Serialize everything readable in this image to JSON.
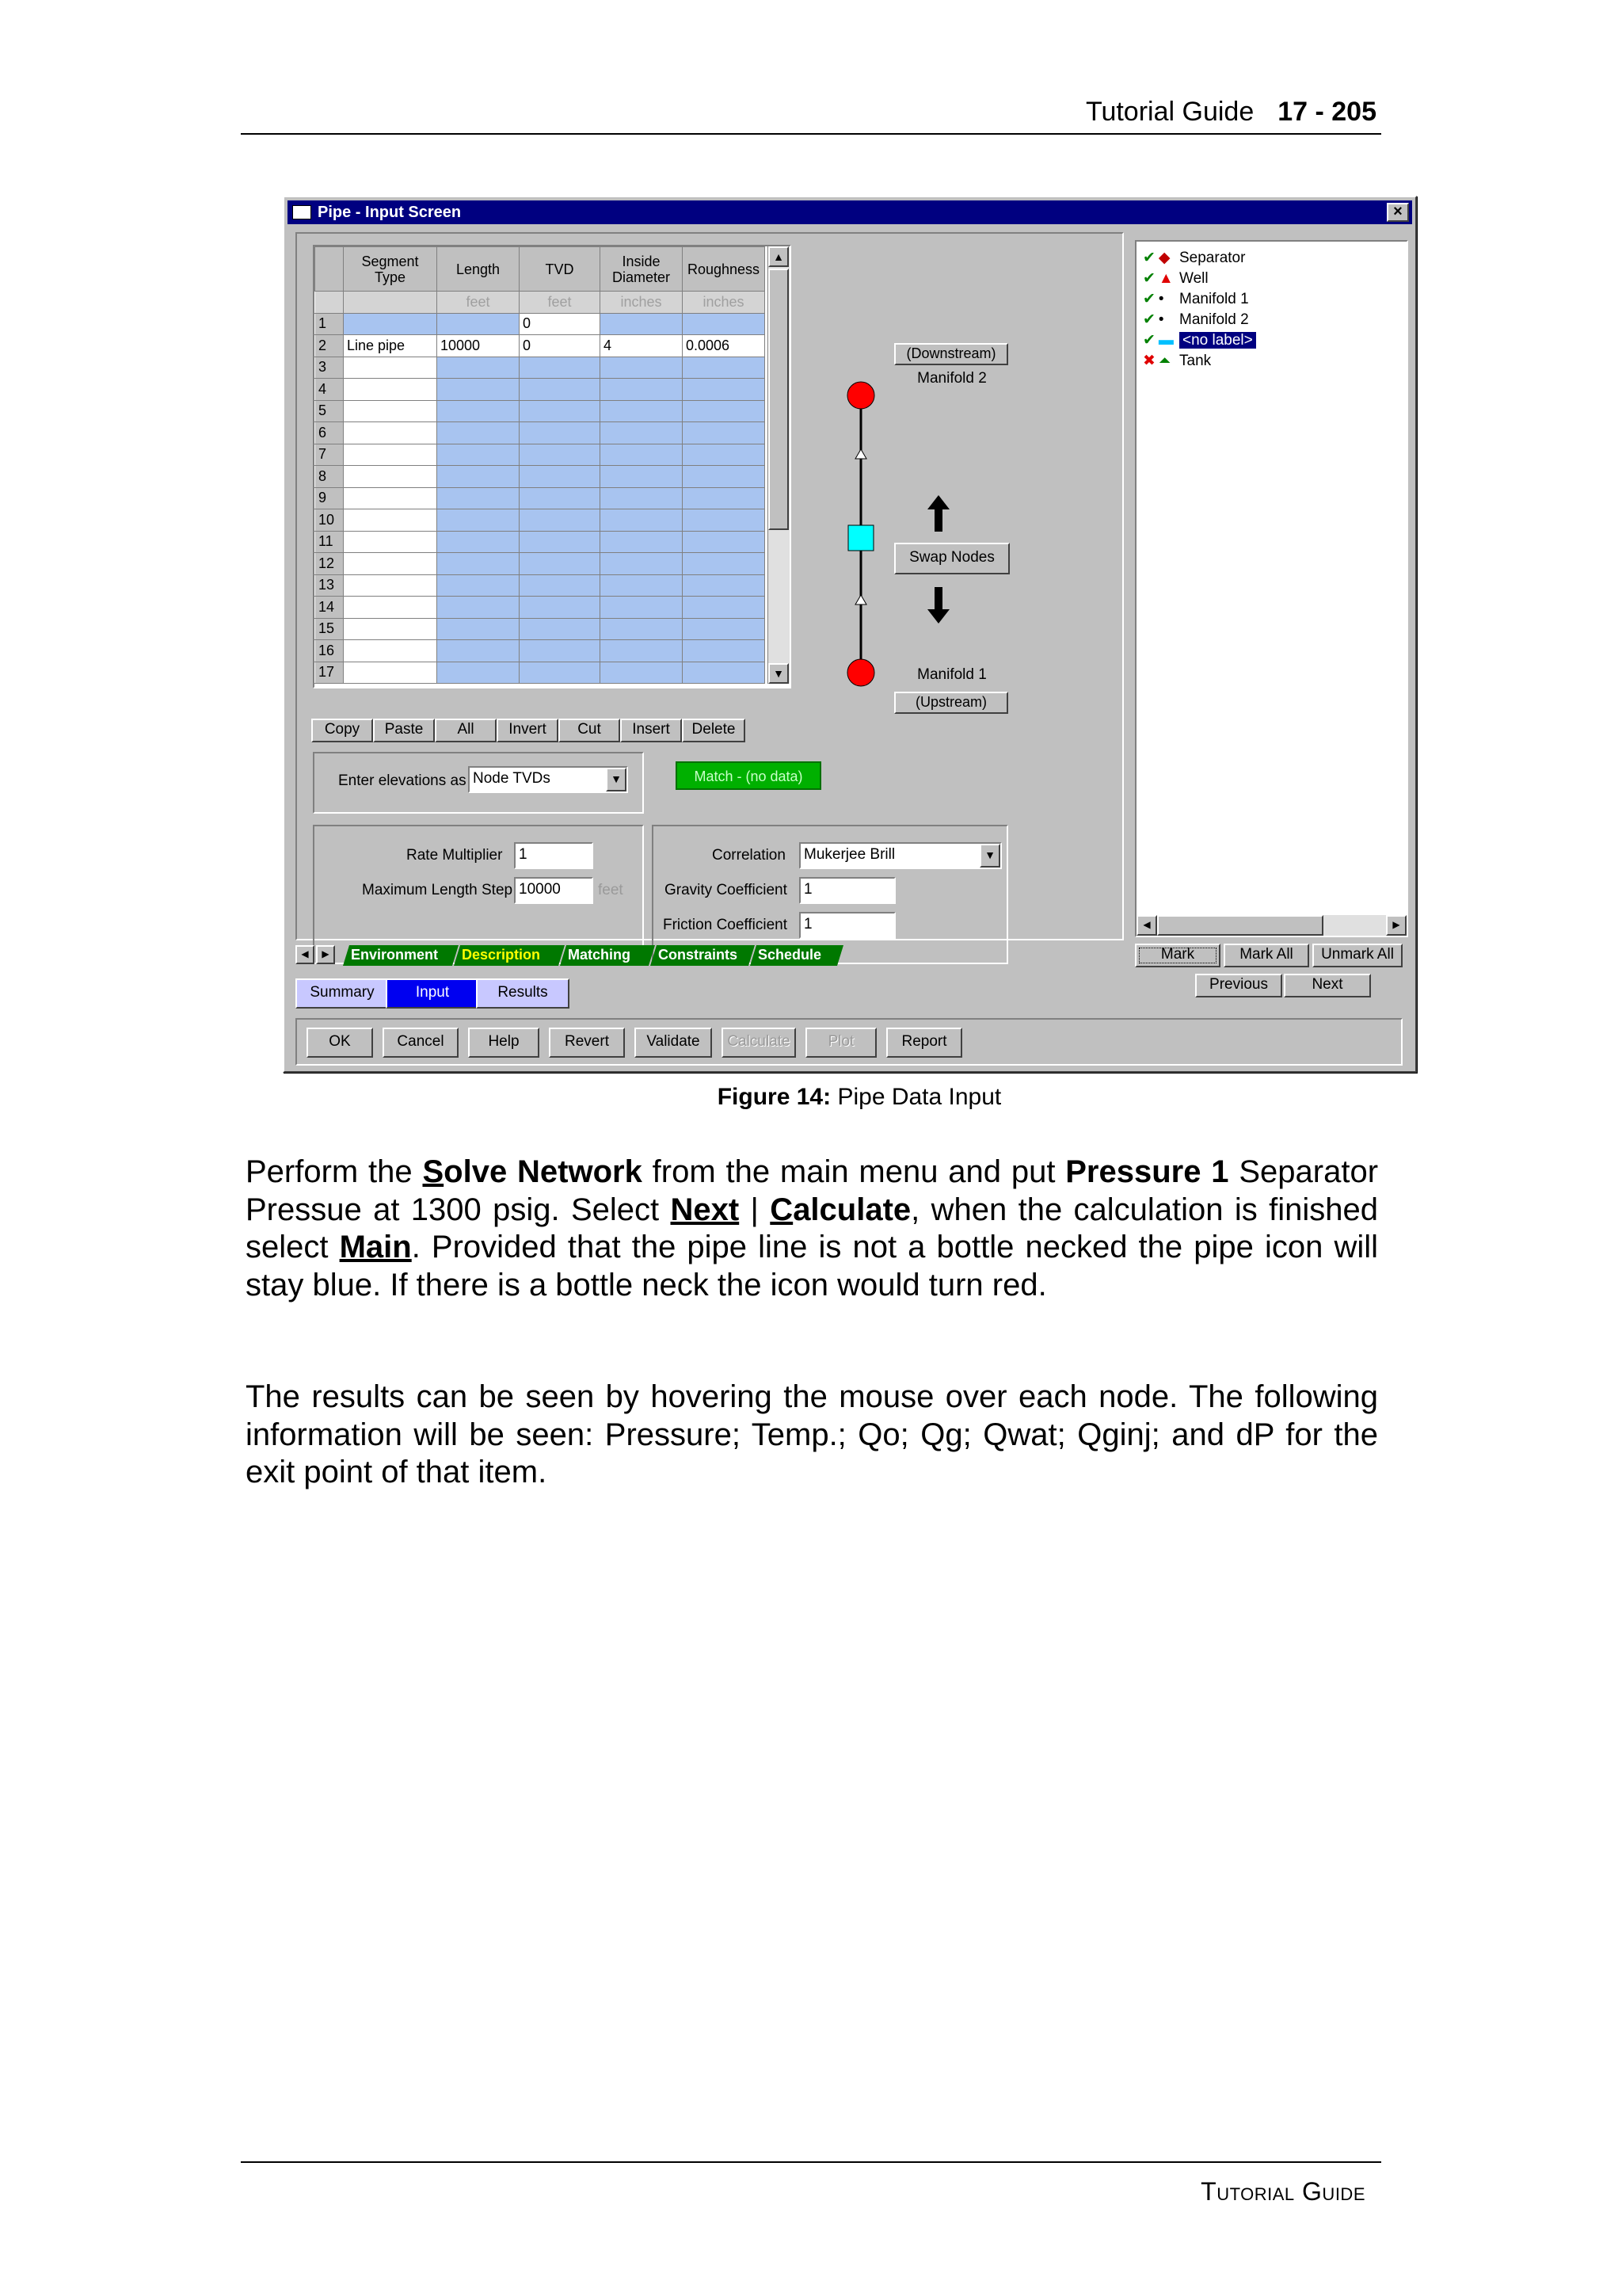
{
  "page_header": {
    "title": "Tutorial Guide",
    "page_number": "17 - 205"
  },
  "window": {
    "title": "Pipe - Input Screen",
    "close_label": "×",
    "grid": {
      "headers": [
        "Segment Type",
        "Length",
        "TVD",
        "Inside Diameter",
        "Roughness"
      ],
      "units": [
        "",
        "feet",
        "feet",
        "inches",
        "inches"
      ],
      "rows": [
        {
          "n": "1",
          "type": "",
          "length": "",
          "tvd": "0",
          "diameter": "",
          "roughness": ""
        },
        {
          "n": "2",
          "type": "Line pipe",
          "length": "10000",
          "tvd": "0",
          "diameter": "4",
          "roughness": "0.0006"
        },
        {
          "n": "3",
          "type": "",
          "length": "",
          "tvd": "",
          "diameter": "",
          "roughness": ""
        },
        {
          "n": "4",
          "type": "",
          "length": "",
          "tvd": "",
          "diameter": "",
          "roughness": ""
        },
        {
          "n": "5",
          "type": "",
          "length": "",
          "tvd": "",
          "diameter": "",
          "roughness": ""
        },
        {
          "n": "6",
          "type": "",
          "length": "",
          "tvd": "",
          "diameter": "",
          "roughness": ""
        },
        {
          "n": "7",
          "type": "",
          "length": "",
          "tvd": "",
          "diameter": "",
          "roughness": ""
        },
        {
          "n": "8",
          "type": "",
          "length": "",
          "tvd": "",
          "diameter": "",
          "roughness": ""
        },
        {
          "n": "9",
          "type": "",
          "length": "",
          "tvd": "",
          "diameter": "",
          "roughness": ""
        },
        {
          "n": "10",
          "type": "",
          "length": "",
          "tvd": "",
          "diameter": "",
          "roughness": ""
        },
        {
          "n": "11",
          "type": "",
          "length": "",
          "tvd": "",
          "diameter": "",
          "roughness": ""
        },
        {
          "n": "12",
          "type": "",
          "length": "",
          "tvd": "",
          "diameter": "",
          "roughness": ""
        },
        {
          "n": "13",
          "type": "",
          "length": "",
          "tvd": "",
          "diameter": "",
          "roughness": ""
        },
        {
          "n": "14",
          "type": "",
          "length": "",
          "tvd": "",
          "diameter": "",
          "roughness": ""
        },
        {
          "n": "15",
          "type": "",
          "length": "",
          "tvd": "",
          "diameter": "",
          "roughness": ""
        },
        {
          "n": "16",
          "type": "",
          "length": "",
          "tvd": "",
          "diameter": "",
          "roughness": ""
        },
        {
          "n": "17",
          "type": "",
          "length": "",
          "tvd": "",
          "diameter": "",
          "roughness": ""
        }
      ]
    },
    "grid_buttons": [
      "Copy",
      "Paste",
      "All",
      "Invert",
      "Cut",
      "Insert",
      "Delete"
    ],
    "diagram": {
      "downstream_label": "(Downstream)",
      "downstream_node": "Manifold 2",
      "swap_label": "Swap Nodes",
      "upstream_node": "Manifold 1",
      "upstream_label": "(Upstream)",
      "node_color": "#ff0000",
      "pipe_color": "#00ffff"
    },
    "elevations": {
      "label": "Enter elevations as",
      "value": "Node TVDs"
    },
    "match_button": "Match - (no data)",
    "rate_multiplier": {
      "label": "Rate Multiplier",
      "value": "1"
    },
    "max_length_step": {
      "label": "Maximum Length Step",
      "value": "10000",
      "unit": "feet"
    },
    "correlation": {
      "label": "Correlation",
      "value": "Mukerjee Brill"
    },
    "gravity_coefficient": {
      "label": "Gravity Coefficient",
      "value": "1"
    },
    "friction_coefficient": {
      "label": "Friction Coefficient",
      "value": "1"
    },
    "tabs": [
      "Environment",
      "Description",
      "Matching",
      "Constraints",
      "Schedule"
    ],
    "active_tab": "Description",
    "tree": [
      {
        "label": "Separator",
        "status": "ok",
        "icon": "separator-icon"
      },
      {
        "label": "Well",
        "status": "ok",
        "icon": "well-icon"
      },
      {
        "label": "Manifold 1",
        "status": "ok",
        "icon": "manifold-icon"
      },
      {
        "label": "Manifold 2",
        "status": "ok",
        "icon": "manifold-icon"
      },
      {
        "label": "<no label>",
        "status": "ok",
        "icon": "pipe-icon",
        "selected": true
      },
      {
        "label": "Tank",
        "status": "error",
        "icon": "tank-icon"
      }
    ],
    "mark_buttons": [
      "Mark",
      "Mark All",
      "Unmark All"
    ],
    "nav_buttons": [
      "Previous",
      "Next"
    ],
    "mode_buttons": [
      "Summary",
      "Input",
      "Results"
    ],
    "active_mode": "Input",
    "bottom_buttons": [
      {
        "label": "OK",
        "enabled": true
      },
      {
        "label": "Cancel",
        "enabled": true
      },
      {
        "label": "Help",
        "enabled": true
      },
      {
        "label": "Revert",
        "enabled": true
      },
      {
        "label": "Validate",
        "enabled": true
      },
      {
        "label": "Calculate",
        "enabled": false
      },
      {
        "label": "Plot",
        "enabled": false
      },
      {
        "label": "Report",
        "enabled": true
      }
    ]
  },
  "caption": {
    "prefix": "Figure 14:",
    "text": "Pipe Data Input"
  },
  "body": {
    "p1": {
      "perform_the": "Perform the ",
      "solve_network": "Solve Network",
      "from_menu": " from the main menu and put ",
      "pressure_1": "Pressure 1",
      "separator_text": " Separator Pressue at 1300 psig.  Select ",
      "next": "Next",
      "pipe_sep": " | ",
      "calculate": "Calculate",
      "when_done": ", when the calculation is finished select ",
      "main": "Main",
      "rest": ".  Provided that the pipe line is not a bottle necked the pipe icon will stay blue.  If there is a bottle neck the icon would turn red."
    },
    "p2": "The results can be seen by hovering the mouse over each node.  The following information will be seen: Pressure; Temp.; Qo; Qg; Qwat; Qginj; and dP for the exit point of that item."
  },
  "page_footer": "Tutorial Guide"
}
